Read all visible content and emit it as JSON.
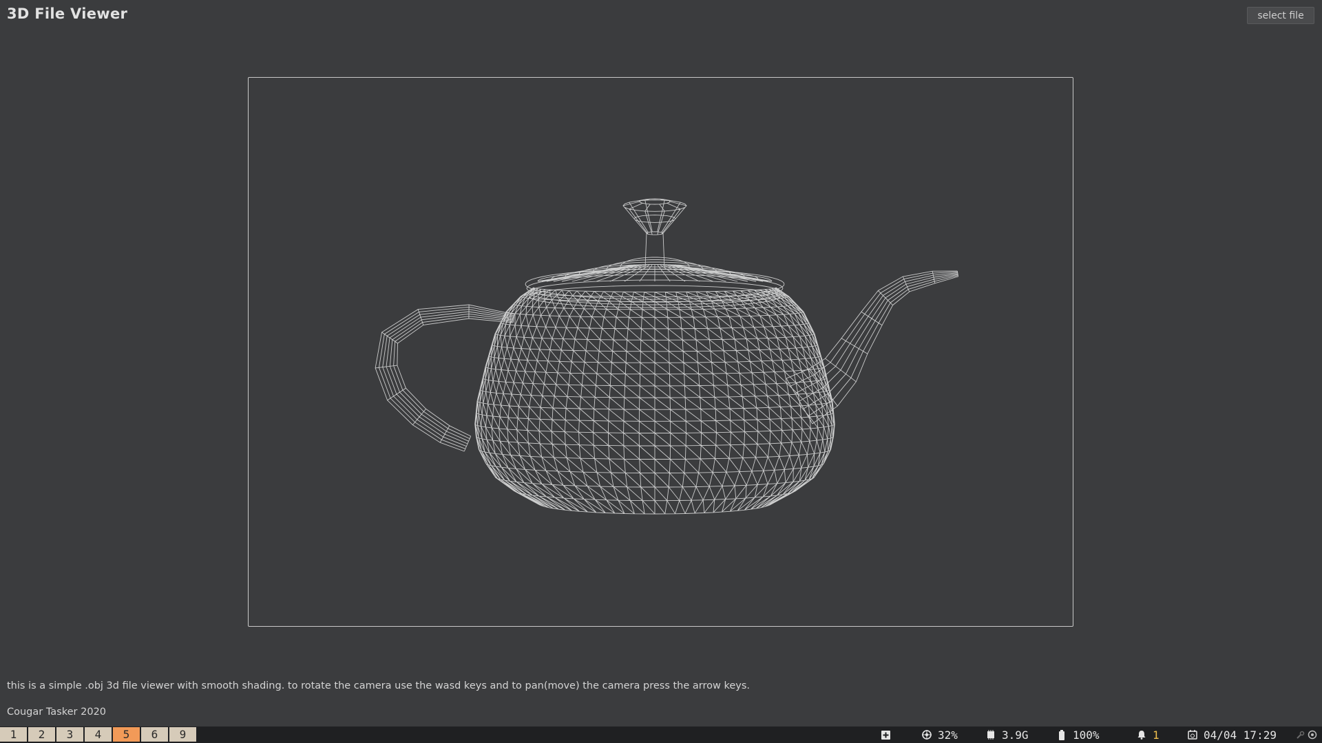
{
  "header": {
    "title": "3D File Viewer",
    "select_file_label": "select file"
  },
  "viewer": {
    "model": "teapot",
    "render_mode": "wireframe",
    "line_color": "#e6e6e6",
    "background_color": "#3b3c3e"
  },
  "description": "this is a simple .obj 3d file viewer with smooth shading. to rotate the camera use the wasd keys and to pan(move) the camera press the arrow keys.",
  "footer": "Cougar Tasker 2020",
  "taskbar": {
    "workspaces": [
      "1",
      "2",
      "3",
      "4",
      "5",
      "6",
      "9"
    ],
    "active_workspace": "5",
    "cpu": "32%",
    "memory": "3.9G",
    "battery": "100%",
    "notifications": "1",
    "datetime": "04/04 17:29",
    "colors": {
      "active_workspace": "#f29a58",
      "workspace": "#d6cbb9",
      "bar": "#1f2022",
      "notification_count": "#f2c14e"
    }
  }
}
